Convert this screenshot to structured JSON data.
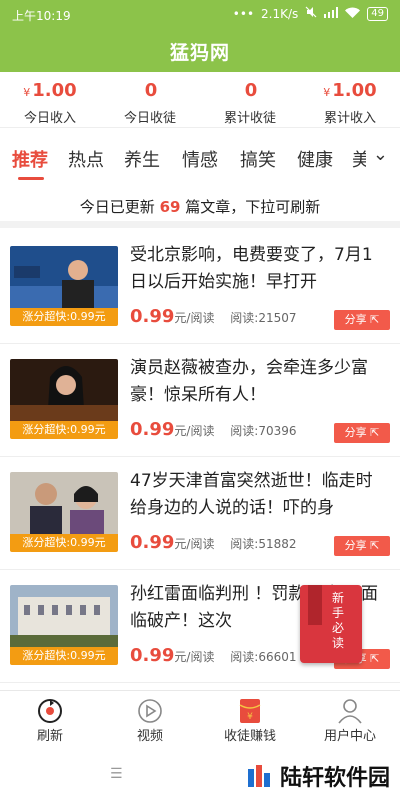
{
  "status_bar": {
    "time": "上午10:19",
    "speed": "2.1K/s",
    "battery": "49"
  },
  "app": {
    "title": "猛犸网"
  },
  "stats": [
    {
      "currency": "¥",
      "value": "1.00",
      "label": "今日收入"
    },
    {
      "currency": "",
      "value": "0",
      "label": "今日收徒"
    },
    {
      "currency": "",
      "value": "0",
      "label": "累计收徒"
    },
    {
      "currency": "¥",
      "value": "1.00",
      "label": "累计收入"
    }
  ],
  "tabs": [
    "推荐",
    "热点",
    "养生",
    "情感",
    "搞笑",
    "健康",
    "美"
  ],
  "notice": {
    "prefix": "今日已更新",
    "count": "69",
    "suffix": "篇文章，下拉可刷新"
  },
  "articles": [
    {
      "title": "受北京影响，电费要变了，7月1日以后开始实施！早打开",
      "tag": "涨分超快:0.99元",
      "price": "0.99",
      "unit": "元/阅读",
      "reads": "阅读:21507",
      "share": "分享"
    },
    {
      "title": "演员赵薇被查办，会牵连多少富豪！惊呆所有人！",
      "tag": "涨分超快:0.99元",
      "price": "0.99",
      "unit": "元/阅读",
      "reads": "阅读:70396",
      "share": "分享"
    },
    {
      "title": "47岁天津首富突然逝世！临走时给身边的人说的话！吓的身",
      "tag": "涨分超快:0.99元",
      "price": "0.99",
      "unit": "元/阅读",
      "reads": "阅读:51882",
      "share": "分享"
    },
    {
      "title": "孙红雷面临判刑 ！罚款20亿，面临破产！这次",
      "tag": "涨分超快:0.99元",
      "price": "0.99",
      "unit": "元/阅读",
      "reads": "阅读:66601",
      "share": "分享"
    }
  ],
  "float_badge": {
    "text": "新手必读"
  },
  "bottom_nav": [
    {
      "label": "刷新",
      "icon": "refresh-icon"
    },
    {
      "label": "视频",
      "icon": "play-icon"
    },
    {
      "label": "收徒赚钱",
      "icon": "red-envelope-icon"
    },
    {
      "label": "用户中心",
      "icon": "user-icon"
    }
  ],
  "watermark": {
    "text": "陆轩软件园"
  },
  "colors": {
    "header": "#8cc34a",
    "accent": "#e84c3d",
    "tag": "#f39c12"
  }
}
